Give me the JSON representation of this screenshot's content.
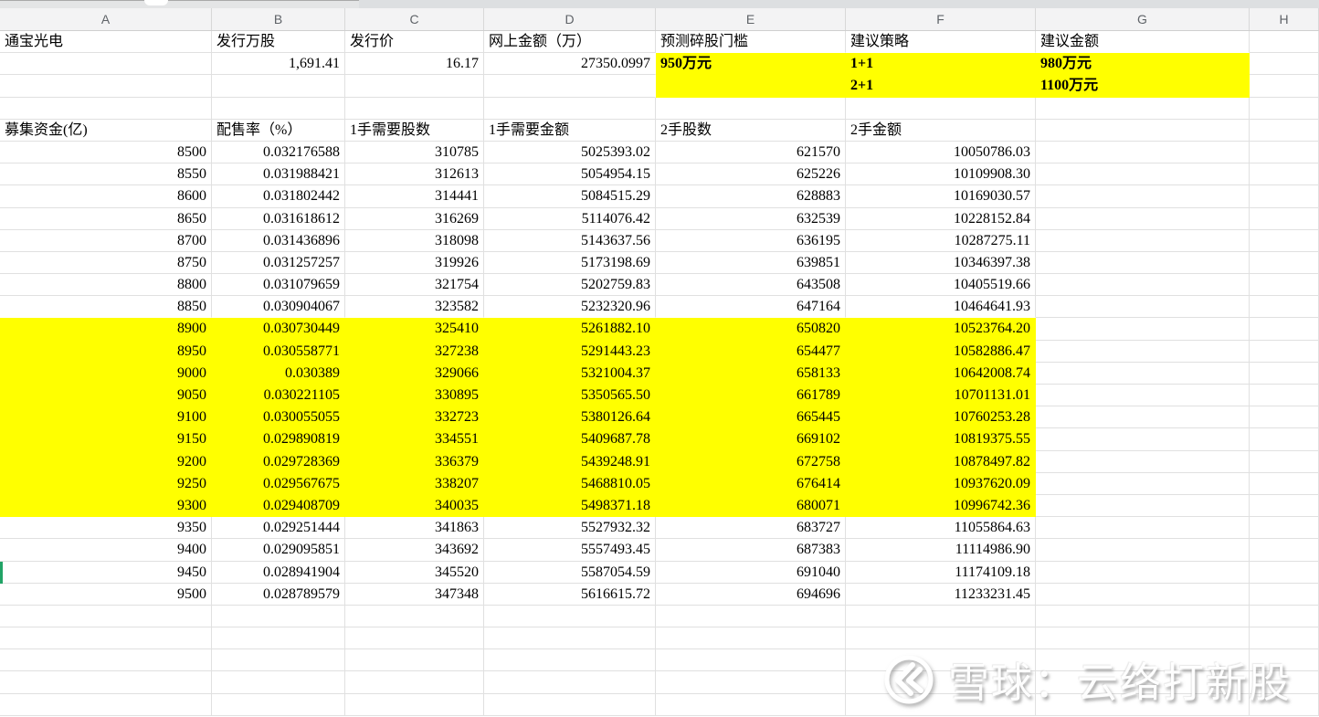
{
  "colors": {
    "highlight": "#ffff00",
    "grid_line": "#e0e0e0",
    "header_bg": "#f3f3f4",
    "header_text": "#5f6368",
    "selection_green": "#21a366"
  },
  "column_headers": [
    "A",
    "B",
    "C",
    "D",
    "E",
    "F",
    "G",
    "H"
  ],
  "info": {
    "title_row": {
      "name": "通宝光电",
      "shares": "发行万股",
      "price": "发行价",
      "online_amount": "网上金额（万）",
      "threshold": "预测碎股门槛",
      "strategy": "建议策略",
      "amount": "建议金额"
    },
    "value_row": {
      "shares": "1,691.41",
      "price": "16.17",
      "online_amount": "27350.0997",
      "threshold": "950万元",
      "strategy1": "1+1",
      "amount1": "980万元"
    },
    "row3": {
      "strategy2": "2+1",
      "amount2": "1100万元"
    }
  },
  "data_table": {
    "headers": [
      "募集资金(亿)",
      "配售率（%）",
      "1手需要股数",
      "1手需要金额",
      "2手股数",
      "2手金额"
    ],
    "rows": [
      [
        "8500",
        "0.032176588",
        "310785",
        "5025393.02",
        "621570",
        "10050786.03"
      ],
      [
        "8550",
        "0.031988421",
        "312613",
        "5054954.15",
        "625226",
        "10109908.30"
      ],
      [
        "8600",
        "0.031802442",
        "314441",
        "5084515.29",
        "628883",
        "10169030.57"
      ],
      [
        "8650",
        "0.031618612",
        "316269",
        "5114076.42",
        "632539",
        "10228152.84"
      ],
      [
        "8700",
        "0.031436896",
        "318098",
        "5143637.56",
        "636195",
        "10287275.11"
      ],
      [
        "8750",
        "0.031257257",
        "319926",
        "5173198.69",
        "639851",
        "10346397.38"
      ],
      [
        "8800",
        "0.031079659",
        "321754",
        "5202759.83",
        "643508",
        "10405519.66"
      ],
      [
        "8850",
        "0.030904067",
        "323582",
        "5232320.96",
        "647164",
        "10464641.93"
      ],
      [
        "8900",
        "0.030730449",
        "325410",
        "5261882.10",
        "650820",
        "10523764.20"
      ],
      [
        "8950",
        "0.030558771",
        "327238",
        "5291443.23",
        "654477",
        "10582886.47"
      ],
      [
        "9000",
        "0.030389",
        "329066",
        "5321004.37",
        "658133",
        "10642008.74"
      ],
      [
        "9050",
        "0.030221105",
        "330895",
        "5350565.50",
        "661789",
        "10701131.01"
      ],
      [
        "9100",
        "0.030055055",
        "332723",
        "5380126.64",
        "665445",
        "10760253.28"
      ],
      [
        "9150",
        "0.029890819",
        "334551",
        "5409687.78",
        "669102",
        "10819375.55"
      ],
      [
        "9200",
        "0.029728369",
        "336379",
        "5439248.91",
        "672758",
        "10878497.82"
      ],
      [
        "9250",
        "0.029567675",
        "338207",
        "5468810.05",
        "676414",
        "10937620.09"
      ],
      [
        "9300",
        "0.029408709",
        "340035",
        "5498371.18",
        "680071",
        "10996742.36"
      ],
      [
        "9350",
        "0.029251444",
        "341863",
        "5527932.32",
        "683727",
        "11055864.63"
      ],
      [
        "9400",
        "0.029095851",
        "343692",
        "5557493.45",
        "687383",
        "11114986.90"
      ],
      [
        "9450",
        "0.028941904",
        "345520",
        "5587054.59",
        "691040",
        "11174109.18"
      ],
      [
        "9500",
        "0.028789579",
        "347348",
        "5616615.72",
        "694696",
        "11233231.45"
      ]
    ],
    "highlight": {
      "from": "8900",
      "to": "9300"
    },
    "empty_rows_after": 5
  },
  "watermark": {
    "text": "雪球：云络打新股"
  }
}
